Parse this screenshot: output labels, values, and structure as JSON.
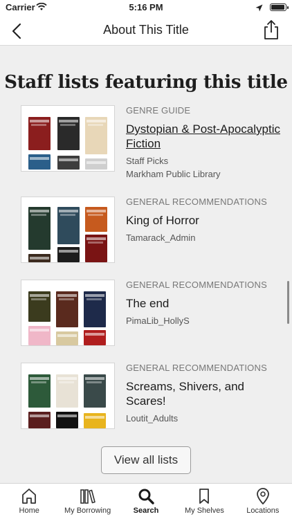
{
  "status_bar": {
    "carrier": "Carrier",
    "time": "5:16 PM"
  },
  "nav": {
    "title": "About This Title",
    "back_icon": "chevron-left-icon",
    "share_icon": "share-icon"
  },
  "section": {
    "title": "Staff lists featuring this title"
  },
  "lists": [
    {
      "category": "GENRE GUIDE",
      "title": "Dystopian & Post-Apocalyptic Fiction",
      "meta1": "Staff Picks",
      "meta2": "Markham Public Library",
      "linked": true,
      "covers": [
        "#8b1e1e",
        "#2a2a2a",
        "#e8d7b8",
        "#2b5f8a",
        "#3d3d3d",
        "#cfcfcf"
      ]
    },
    {
      "category": "GENERAL RECOMMENDATIONS",
      "title": "King of Horror",
      "meta1": "Tamarack_Admin",
      "covers": [
        "#243a2e",
        "#2f4b5c",
        "#c65a1e",
        "#3b2a1e",
        "#1c1c1c",
        "#7a1414"
      ]
    },
    {
      "category": "GENERAL RECOMMENDATIONS",
      "title": "The end",
      "meta1": "PimaLib_HollyS",
      "covers": [
        "#3b3b1e",
        "#5a2a1e",
        "#1e2a4a",
        "#f0b7c8",
        "#d8c9a0",
        "#b01e1e"
      ]
    },
    {
      "category": "GENERAL RECOMMENDATIONS",
      "title": "Screams, Shivers, and Scares!",
      "meta1": "Loutit_Adults",
      "covers": [
        "#2d5a3a",
        "#e8e2d6",
        "#3a4a4a",
        "#5a1e1e",
        "#111111",
        "#e8b41e"
      ]
    }
  ],
  "view_all_label": "View all lists",
  "tabs": [
    {
      "label": "Home",
      "icon": "home-icon"
    },
    {
      "label": "My Borrowing",
      "icon": "books-icon"
    },
    {
      "label": "Search",
      "icon": "search-icon",
      "active": true
    },
    {
      "label": "My Shelves",
      "icon": "bookmark-icon"
    },
    {
      "label": "Locations",
      "icon": "location-pin-icon"
    }
  ]
}
